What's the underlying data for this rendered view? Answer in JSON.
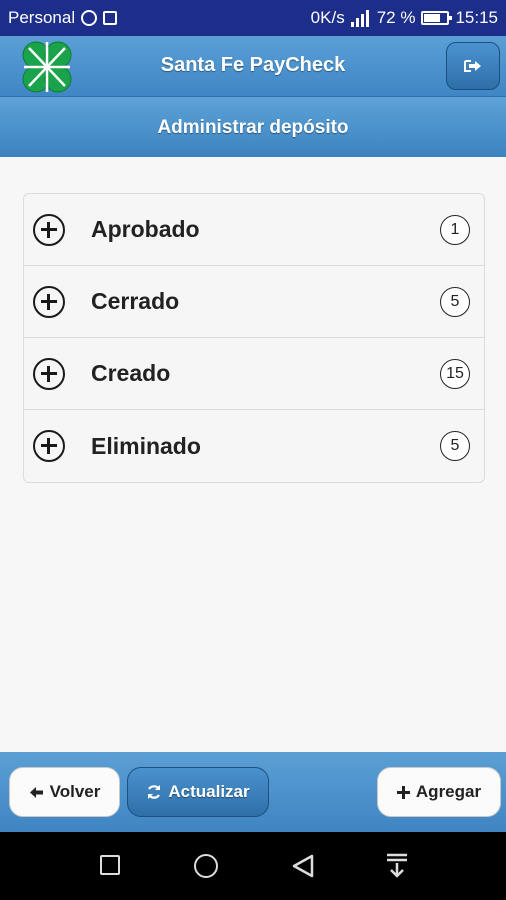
{
  "status_bar": {
    "carrier": "Personal",
    "speed": "0K/s",
    "battery": "72 %",
    "battery_level": 0.72,
    "time": "15:15",
    "icons": [
      "whatsapp-icon",
      "image-icon",
      "signal-icon",
      "battery-icon"
    ]
  },
  "header": {
    "title": "Santa Fe PayCheck",
    "logout_icon": "logout-icon",
    "logo_color": "#1aa34a"
  },
  "subheader": {
    "title": "Administrar depósito"
  },
  "list": {
    "items": [
      {
        "label": "Aprobado",
        "count": "1"
      },
      {
        "label": "Cerrado",
        "count": "5"
      },
      {
        "label": "Creado",
        "count": "15"
      },
      {
        "label": "Eliminado",
        "count": "5"
      }
    ]
  },
  "footer": {
    "back_label": "Volver",
    "refresh_label": "Actualizar",
    "add_label": "Agregar"
  },
  "colors": {
    "accent": "#4a92ce",
    "status_bar": "#1c2d8a"
  }
}
